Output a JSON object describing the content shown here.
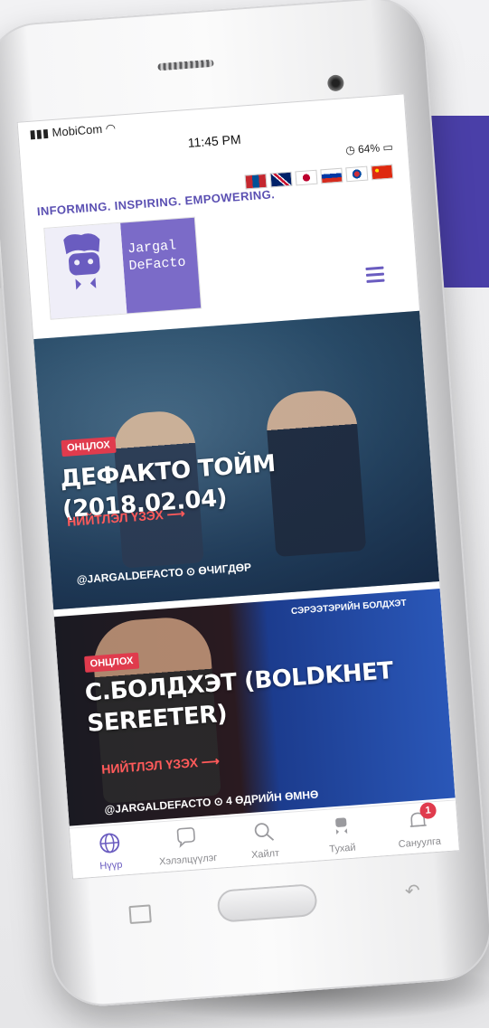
{
  "status": {
    "carrier": "MobiCom",
    "time": "11:45 PM",
    "battery": "64%"
  },
  "header": {
    "tagline": "INFORMING. INSPIRING. EMPOWERING.",
    "logo_line1": "Jargal",
    "logo_line2": "DeFacto",
    "flags": [
      "mongolia",
      "uk",
      "japan",
      "russia",
      "korea",
      "china"
    ]
  },
  "cards": [
    {
      "badge": "ОНЦЛОХ",
      "title": "ДЕФАКТО ТОЙМ (2018.02.04)",
      "readmore": "НИЙТЛЭЛ ҮЗЭХ ⟶",
      "author": "@JARGALDEFACTO",
      "time": "ӨЧИГДӨР"
    },
    {
      "badge": "ОНЦЛОХ",
      "title_line1": "С.БОЛДХЭТ (BOLDKHET",
      "title_line2": "SEREETER)",
      "readmore": "НИЙТЛЭЛ ҮЗЭХ ⟶",
      "author": "@JARGALDEFACTO",
      "time": "4 ӨДРИЙН ӨМНӨ",
      "slide_title": "СЭРЭЭТЭРИЙН БОЛДХЭТ"
    }
  ],
  "tabs": [
    {
      "label": "Нүүр",
      "icon": "globe-icon",
      "active": true
    },
    {
      "label": "Хэлэлцүүлэг",
      "icon": "chat-icon",
      "active": false
    },
    {
      "label": "Хайлт",
      "icon": "search-icon",
      "active": false
    },
    {
      "label": "Тухай",
      "icon": "profile-icon",
      "active": false
    },
    {
      "label": "Сануулга",
      "icon": "bell-icon",
      "active": false,
      "badge": "1"
    }
  ],
  "colors": {
    "brand": "#6a5cc0",
    "accent_red": "#e03b4d",
    "background_block": "#4a3fa8"
  }
}
